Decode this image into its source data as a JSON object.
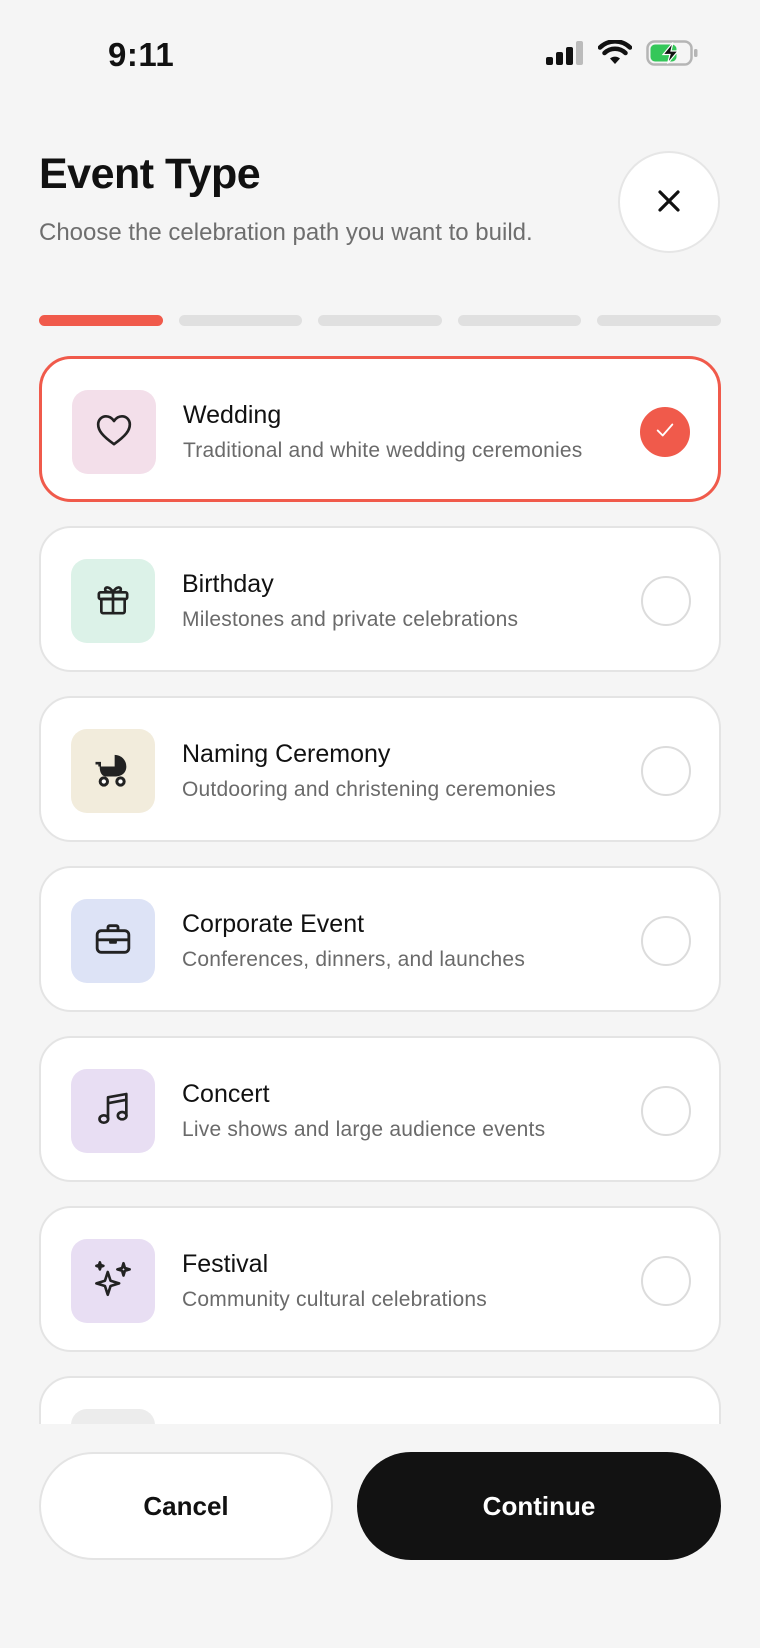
{
  "status_bar": {
    "time": "9:11",
    "icons": [
      "cellular-signal-icon",
      "wifi-icon",
      "battery-charging-icon"
    ],
    "battery_color": "#34c759"
  },
  "header": {
    "title": "Event Type",
    "subtitle": "Choose the celebration path you want to build.",
    "close_icon": "close-icon"
  },
  "progress": {
    "total_steps": 5,
    "current_step": 1,
    "active_color": "#f05a4b"
  },
  "event_types": [
    {
      "label": "Wedding",
      "description": "Traditional and white wedding ceremonies",
      "icon": "heart-icon",
      "icon_bg": "#f3dfea",
      "selected": true
    },
    {
      "label": "Birthday",
      "description": "Milestones and private celebrations",
      "icon": "gift-icon",
      "icon_bg": "#dcf2e8",
      "selected": false
    },
    {
      "label": "Naming Ceremony",
      "description": "Outdooring and christening ceremonies",
      "icon": "baby-stroller-icon",
      "icon_bg": "#f2ecdc",
      "selected": false
    },
    {
      "label": "Corporate Event",
      "description": "Conferences, dinners, and launches",
      "icon": "briefcase-icon",
      "icon_bg": "#dde3f6",
      "selected": false
    },
    {
      "label": "Concert",
      "description": "Live shows and large audience events",
      "icon": "music-note-icon",
      "icon_bg": "#e8def3",
      "selected": false
    },
    {
      "label": "Festival",
      "description": "Community cultural celebrations",
      "icon": "sparkles-icon",
      "icon_bg": "#e8def3",
      "selected": false
    }
  ],
  "footer": {
    "cancel_label": "Cancel",
    "continue_label": "Continue"
  }
}
